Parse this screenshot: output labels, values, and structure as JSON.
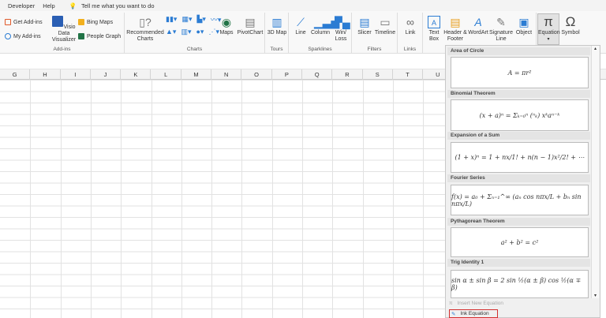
{
  "menu": {
    "developer": "Developer",
    "help": "Help",
    "tell_me": "Tell me what you want to do"
  },
  "ribbon": {
    "addins": {
      "get": "Get Add-ins",
      "my": "My Add-ins",
      "visio": "Visio Data Visualizer",
      "bing": "Bing Maps",
      "people": "People Graph",
      "label": "Add-ins"
    },
    "charts": {
      "recommended": "Recommended Charts",
      "maps": "Maps",
      "pivot": "PivotChart",
      "label": "Charts"
    },
    "tours": {
      "map3d": "3D Map",
      "label": "Tours"
    },
    "sparklines": {
      "line": "Line",
      "column": "Column",
      "winloss": "Win/ Loss",
      "label": "Sparklines"
    },
    "filters": {
      "slicer": "Slicer",
      "timeline": "Timeline",
      "label": "Filters"
    },
    "links": {
      "link": "Link",
      "label": "Links"
    },
    "text": {
      "textbox": "Text Box",
      "header": "Header & Footer",
      "wordart": "WordArt",
      "signature": "Signature Line",
      "object": "Object"
    },
    "symbols": {
      "equation": "Equation",
      "symbol": "Symbol",
      "equation_icon": "π",
      "symbol_icon": "Ω"
    }
  },
  "columns": [
    "G",
    "H",
    "I",
    "J",
    "K",
    "L",
    "M",
    "N",
    "O",
    "P",
    "Q",
    "R",
    "S",
    "T",
    "U"
  ],
  "gallery": [
    {
      "title": "Area of Circle",
      "eq": "A = πr²"
    },
    {
      "title": "Binomial Theorem",
      "eq": "(x + a)ⁿ = Σₖ₌₀ⁿ (ⁿₖ) xᵏaⁿ⁻ᵏ"
    },
    {
      "title": "Expansion of a Sum",
      "eq": "(1 + x)ⁿ = 1 + nx/1! + n(n − 1)x²/2! + ⋯"
    },
    {
      "title": "Fourier Series",
      "eq": "f(x) = a₀ + Σₙ₌₁^∞ (aₙ cos nπx/L + bₙ sin nπx/L)"
    },
    {
      "title": "Pythagorean Theorem",
      "eq": "a² + b² = c²"
    },
    {
      "title": "Trig Identity 1",
      "eq": "sin α ± sin β = 2 sin ½(α ± β) cos ½(α ∓ β)"
    }
  ],
  "footer": {
    "insert": "Insert New Equation",
    "ink": "Ink Equation"
  },
  "colors": {
    "highlight": "#d32f2f",
    "accent": "#217346"
  }
}
